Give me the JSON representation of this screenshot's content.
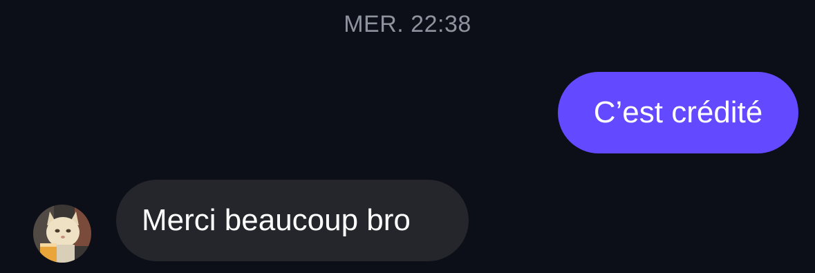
{
  "conversation": {
    "timestamp": "MER. 22:38",
    "messages": [
      {
        "direction": "outgoing",
        "text": "C’est crédité"
      },
      {
        "direction": "incoming",
        "text": "Merci beaucoup bro"
      }
    ]
  },
  "avatar": {
    "icon": "cat-avatar-photo"
  },
  "colors": {
    "background": "#0c0f17",
    "outgoing_bubble": "#6349ff",
    "incoming_bubble": "#24262c",
    "timestamp_text": "#8e939d",
    "message_text": "#ffffff"
  }
}
